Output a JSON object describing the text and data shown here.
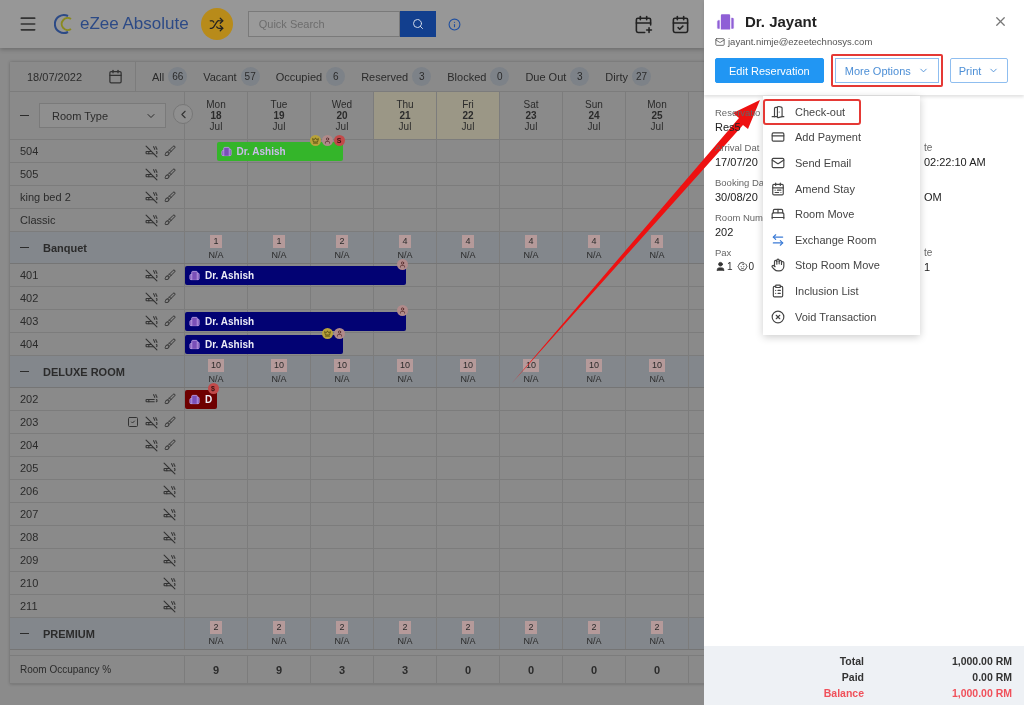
{
  "header": {
    "logo": "eZee Absolute",
    "search": {
      "placeholder": "Quick Search"
    }
  },
  "filter": {
    "date": "18/07/2022",
    "counts": [
      {
        "label": "All",
        "count": "66"
      },
      {
        "label": "Vacant",
        "count": "57"
      },
      {
        "label": "Occupied",
        "count": "6"
      },
      {
        "label": "Reserved",
        "count": "3"
      },
      {
        "label": "Blocked",
        "count": "0"
      },
      {
        "label": "Due Out",
        "count": "3"
      },
      {
        "label": "Dirty",
        "count": "27"
      }
    ]
  },
  "grid": {
    "room_type_select": "Room Type",
    "days": [
      {
        "dow": "Mon",
        "day": "18",
        "month": "Jul",
        "highlighted": false
      },
      {
        "dow": "Tue",
        "day": "19",
        "month": "Jul",
        "highlighted": false
      },
      {
        "dow": "Wed",
        "day": "20",
        "month": "Jul",
        "highlighted": false
      },
      {
        "dow": "Thu",
        "day": "21",
        "month": "Jul",
        "highlighted": true
      },
      {
        "dow": "Fri",
        "day": "22",
        "month": "Jul",
        "highlighted": true
      },
      {
        "dow": "Sat",
        "day": "23",
        "month": "Jul",
        "highlighted": false
      },
      {
        "dow": "Sun",
        "day": "24",
        "month": "Jul",
        "highlighted": false
      },
      {
        "dow": "Mon",
        "day": "25",
        "month": "Jul",
        "highlighted": false
      }
    ],
    "rows": [
      {
        "kind": "room",
        "name": "504",
        "smoking": false,
        "dirty": true,
        "task": false,
        "bookings": [
          {
            "guest": "Dr. Ashish",
            "color": "#34b52a",
            "badges": [
              {
                "kind": "vip"
              },
              {
                "kind": "guest"
              },
              {
                "kind": "payment",
                "symbol": "S"
              }
            ]
          }
        ]
      },
      {
        "kind": "room",
        "name": "505",
        "smoking": false,
        "dirty": true,
        "task": false
      },
      {
        "kind": "room",
        "name": "king bed 2",
        "smoking": false,
        "dirty": true,
        "task": false
      },
      {
        "kind": "room",
        "name": "Classic",
        "smoking": false,
        "dirty": true,
        "task": false
      },
      {
        "kind": "group",
        "name": "Banquet",
        "availability": [
          {
            "count": "1",
            "rate": "N/A"
          },
          {
            "count": "1",
            "rate": "N/A"
          },
          {
            "count": "2",
            "rate": "N/A"
          },
          {
            "count": "4",
            "rate": "N/A"
          },
          {
            "count": "4",
            "rate": "N/A"
          },
          {
            "count": "4",
            "rate": "N/A"
          },
          {
            "count": "4",
            "rate": "N/A"
          },
          {
            "count": "4",
            "rate": "N/A"
          }
        ]
      },
      {
        "kind": "room",
        "name": "401",
        "smoking": false,
        "dirty": true,
        "task": false,
        "bookings": [
          {
            "guest": "Dr. Ashish",
            "color": "#020273",
            "badges": [
              {
                "kind": "guest"
              }
            ]
          }
        ]
      },
      {
        "kind": "room",
        "name": "402",
        "smoking": false,
        "dirty": true,
        "task": false
      },
      {
        "kind": "room",
        "name": "403",
        "smoking": false,
        "dirty": true,
        "task": false,
        "bookings": [
          {
            "guest": "Dr. Ashish",
            "color": "#020273",
            "badges": [
              {
                "kind": "guest"
              }
            ]
          }
        ]
      },
      {
        "kind": "room",
        "name": "404",
        "smoking": false,
        "dirty": true,
        "task": false,
        "bookings": [
          {
            "guest": "Dr. Ashish",
            "color": "#020273",
            "badges": [
              {
                "kind": "vip"
              },
              {
                "kind": "guest"
              }
            ]
          }
        ]
      },
      {
        "kind": "group",
        "name": "DELUXE ROOM",
        "availability": [
          {
            "count": "10",
            "rate": "N/A"
          },
          {
            "count": "10",
            "rate": "N/A"
          },
          {
            "count": "10",
            "rate": "N/A"
          },
          {
            "count": "10",
            "rate": "N/A"
          },
          {
            "count": "10",
            "rate": "N/A"
          },
          {
            "count": "10",
            "rate": "N/A"
          },
          {
            "count": "10",
            "rate": "N/A"
          },
          {
            "count": "10",
            "rate": "N/A"
          }
        ]
      },
      {
        "kind": "room",
        "name": "202",
        "smoking": true,
        "dirty": true,
        "task": false,
        "bookings": [
          {
            "guest": "D",
            "color": "#6e0000",
            "badges": [
              {
                "kind": "payment",
                "symbol": "$"
              }
            ]
          }
        ]
      },
      {
        "kind": "room",
        "name": "203",
        "smoking": false,
        "dirty": true,
        "task": true
      },
      {
        "kind": "room",
        "name": "204",
        "smoking": false,
        "dirty": true,
        "task": false
      },
      {
        "kind": "room",
        "name": "205",
        "smoking": false,
        "dirty": false,
        "task": false
      },
      {
        "kind": "room",
        "name": "206",
        "smoking": false,
        "dirty": false,
        "task": false
      },
      {
        "kind": "room",
        "name": "207",
        "smoking": false,
        "dirty": false,
        "task": false
      },
      {
        "kind": "room",
        "name": "208",
        "smoking": false,
        "dirty": false,
        "task": false
      },
      {
        "kind": "room",
        "name": "209",
        "smoking": false,
        "dirty": false,
        "task": false
      },
      {
        "kind": "room",
        "name": "210",
        "smoking": false,
        "dirty": false,
        "task": false
      },
      {
        "kind": "room",
        "name": "211",
        "smoking": false,
        "dirty": false,
        "task": false
      },
      {
        "kind": "group",
        "name": "PREMIUM",
        "availability": [
          {
            "count": "2",
            "rate": "N/A"
          },
          {
            "count": "2",
            "rate": "N/A"
          },
          {
            "count": "2",
            "rate": "N/A"
          },
          {
            "count": "2",
            "rate": "N/A"
          },
          {
            "count": "2",
            "rate": "N/A"
          },
          {
            "count": "2",
            "rate": "N/A"
          },
          {
            "count": "2",
            "rate": "N/A"
          },
          {
            "count": "2",
            "rate": "N/A"
          }
        ]
      }
    ],
    "occupancy": {
      "label": "Room Occupancy %",
      "values": [
        "9",
        "9",
        "3",
        "3",
        "0",
        "0",
        "0",
        "0"
      ]
    }
  },
  "drawer": {
    "guest": "Dr. Jayant",
    "email": "jayant.nimje@ezeetechnosys.com",
    "buttons": [
      {
        "label": "Edit Reservation",
        "kind": "primary",
        "highlighted": false
      },
      {
        "label": "More Options",
        "kind": "dropdown",
        "highlighted": true
      },
      {
        "label": "Print",
        "kind": "dropdown",
        "highlighted": false
      }
    ],
    "details": [
      {
        "left": {
          "label": "Reservatio",
          "value": "Res5"
        }
      },
      {
        "left": {
          "label": "Arrival Dat",
          "value": "17/07/20"
        },
        "right": {
          "label": "te",
          "value": "02:22:10 AM"
        }
      },
      {
        "left": {
          "label": "Booking Da",
          "value": "30/08/20"
        },
        "right": {
          "value": "OM"
        }
      },
      {
        "left": {
          "label": "Room Num",
          "value": "202"
        }
      },
      {
        "left": {
          "label": "Pax",
          "adults": "1",
          "children": "0"
        },
        "right": {
          "label": "te",
          "value": "1"
        }
      }
    ],
    "menu": [
      {
        "label": "Check-out",
        "kind": "checkout",
        "highlighted": true
      },
      {
        "label": "Add Payment",
        "kind": "payment",
        "highlighted": false
      },
      {
        "label": "Send Email",
        "kind": "email",
        "highlighted": false
      },
      {
        "label": "Amend Stay",
        "kind": "amend",
        "highlighted": false
      },
      {
        "label": "Room Move",
        "kind": "move",
        "highlighted": false
      },
      {
        "label": "Exchange Room",
        "kind": "exchange",
        "highlighted": false
      },
      {
        "label": "Stop Room Move",
        "kind": "stop",
        "highlighted": false
      },
      {
        "label": "Inclusion List",
        "kind": "inclusion",
        "highlighted": false
      },
      {
        "label": "Void Transaction",
        "kind": "void",
        "highlighted": false
      }
    ],
    "totals": [
      {
        "label": "Total",
        "value": "1,000.00 RM",
        "kind": "normal"
      },
      {
        "label": "Paid",
        "value": "0.00 RM",
        "kind": "normal"
      },
      {
        "label": "Balance",
        "value": "1,000.00 RM",
        "kind": "due"
      }
    ]
  }
}
